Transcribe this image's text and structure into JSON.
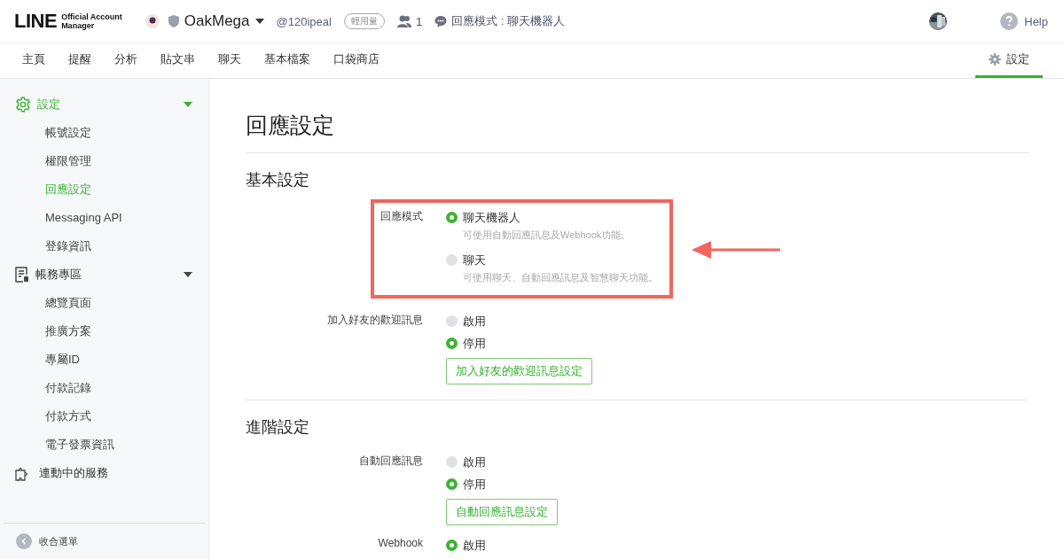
{
  "header": {
    "logo": {
      "wordmark": "LINE",
      "line1": "Official Account",
      "line2": "Manager"
    },
    "account_name": "OakMega",
    "account_id": "@120ipeal",
    "plan_badge": "輕用量",
    "friends_count": "1",
    "response_mode": "回應模式 : 聊天機器人",
    "help": "Help"
  },
  "nav": {
    "tabs": [
      {
        "label": "主頁",
        "selected": false
      },
      {
        "label": "提醒",
        "selected": false
      },
      {
        "label": "分析",
        "selected": false
      },
      {
        "label": "貼文串",
        "selected": false
      },
      {
        "label": "聊天",
        "selected": false
      },
      {
        "label": "基本檔案",
        "selected": false
      },
      {
        "label": "口袋商店",
        "selected": false
      }
    ],
    "settings_tab": {
      "label": "設定",
      "selected": true
    }
  },
  "sidebar": {
    "groups": [
      {
        "label": "設定",
        "kind": "gear",
        "selected": true,
        "expanded": true,
        "children": [
          {
            "label": "帳號設定",
            "selected": false
          },
          {
            "label": "權限管理",
            "selected": false
          },
          {
            "label": "回應設定",
            "selected": true
          },
          {
            "label": "Messaging API",
            "selected": false
          },
          {
            "label": "登錄資訊",
            "selected": false
          }
        ]
      },
      {
        "label": "帳務專區",
        "kind": "document",
        "selected": false,
        "expanded": true,
        "children": [
          {
            "label": "總覽頁面",
            "selected": false
          },
          {
            "label": "推廣方案",
            "selected": false
          },
          {
            "label": "專屬ID",
            "selected": false
          },
          {
            "label": "付款記錄",
            "selected": false
          },
          {
            "label": "付款方式",
            "selected": false
          },
          {
            "label": "電子發票資訊",
            "selected": false
          }
        ]
      },
      {
        "label": "連動中的服務",
        "kind": "puzzle",
        "selected": false
      }
    ],
    "collapse": "收合選單"
  },
  "page": {
    "title": "回應設定",
    "sections": [
      {
        "heading": "基本設定",
        "fields": [
          {
            "label": "回應模式",
            "highlighted": true,
            "options": [
              {
                "label": "聊天機器人",
                "description": "可使用自動回應訊息及Webhook功能。",
                "selected": true
              },
              {
                "label": "聊天",
                "description": "可使用聊天、自動回應訊息及智慧聊天功能。",
                "selected": false
              }
            ]
          },
          {
            "label": "加入好友的歡迎訊息",
            "options": [
              {
                "label": "啟用",
                "selected": false
              },
              {
                "label": "停用",
                "selected": true
              }
            ],
            "button": "加入好友的歡迎訊息設定"
          }
        ]
      },
      {
        "heading": "進階設定",
        "fields": [
          {
            "label": "自動回應訊息",
            "options": [
              {
                "label": "啟用",
                "selected": false
              },
              {
                "label": "停用",
                "selected": true
              }
            ],
            "button": "自動回應訊息設定"
          },
          {
            "label": "Webhook",
            "options": [
              {
                "label": "啟用",
                "selected": true
              }
            ]
          }
        ]
      }
    ]
  }
}
